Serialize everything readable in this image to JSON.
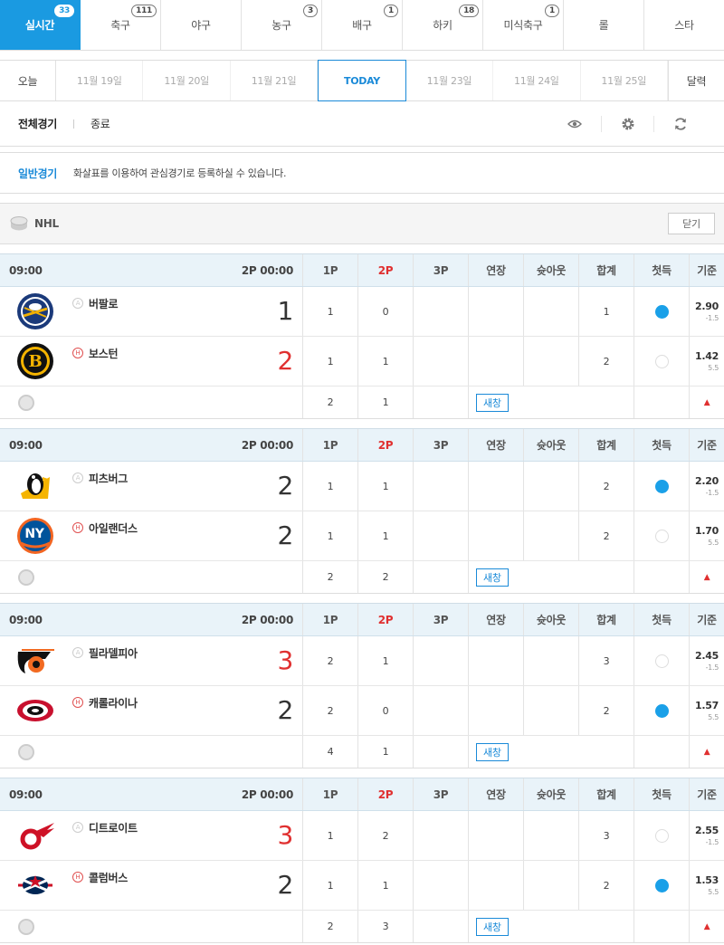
{
  "sports_tabs": [
    {
      "label": "실시간",
      "badge": "33",
      "active": true
    },
    {
      "label": "축구",
      "badge": "111"
    },
    {
      "label": "야구",
      "badge": ""
    },
    {
      "label": "농구",
      "badge": "3"
    },
    {
      "label": "배구",
      "badge": "1"
    },
    {
      "label": "하키",
      "badge": "18"
    },
    {
      "label": "미식축구",
      "badge": "1"
    },
    {
      "label": "롤",
      "badge": ""
    },
    {
      "label": "스타",
      "badge": ""
    }
  ],
  "dates": {
    "today_btn": "오늘",
    "items": [
      "11월 19일",
      "11월 20일",
      "11월 21일",
      "TODAY",
      "11월 23일",
      "11월 24일",
      "11월 25일"
    ],
    "calendar_btn": "달력"
  },
  "filter": {
    "all": "전체경기",
    "finished": "종료"
  },
  "notice": {
    "title": "일반경기",
    "text": "화살표를 이용하여 관심경기로 등록하실 수 있습니다."
  },
  "league": {
    "name": "NHL",
    "close_label": "닫기"
  },
  "columns": [
    "1P",
    "2P",
    "3P",
    "연장",
    "슛아웃",
    "합계",
    "첫득",
    "기준"
  ],
  "new_window_label": "새창",
  "games": [
    {
      "time": "09:00",
      "status": "2P 00:00",
      "away": {
        "mark": "A",
        "name": "버팔로",
        "score": "1",
        "lead": false,
        "p1": "1",
        "p2": "0",
        "total": "1",
        "first": true,
        "odds": "2.90",
        "handicap": "-1.5",
        "logo": "sabres"
      },
      "home": {
        "mark": "H",
        "name": "보스턴",
        "score": "2",
        "lead": true,
        "p1": "1",
        "p2": "1",
        "total": "2",
        "first": false,
        "odds": "1.42",
        "handicap": "5.5",
        "logo": "bruins"
      },
      "sum": {
        "p1": "2",
        "p2": "1"
      }
    },
    {
      "time": "09:00",
      "status": "2P 00:00",
      "away": {
        "mark": "A",
        "name": "피츠버그",
        "score": "2",
        "lead": false,
        "p1": "1",
        "p2": "1",
        "total": "2",
        "first": true,
        "odds": "2.20",
        "handicap": "-1.5",
        "logo": "penguins"
      },
      "home": {
        "mark": "H",
        "name": "아일랜더스",
        "score": "2",
        "lead": false,
        "p1": "1",
        "p2": "1",
        "total": "2",
        "first": false,
        "odds": "1.70",
        "handicap": "5.5",
        "logo": "islanders"
      },
      "sum": {
        "p1": "2",
        "p2": "2"
      }
    },
    {
      "time": "09:00",
      "status": "2P 00:00",
      "away": {
        "mark": "A",
        "name": "필라델피아",
        "score": "3",
        "lead": true,
        "p1": "2",
        "p2": "1",
        "total": "3",
        "first": false,
        "odds": "2.45",
        "handicap": "-1.5",
        "logo": "flyers"
      },
      "home": {
        "mark": "H",
        "name": "캐롤라이나",
        "score": "2",
        "lead": false,
        "p1": "2",
        "p2": "0",
        "total": "2",
        "first": true,
        "odds": "1.57",
        "handicap": "5.5",
        "logo": "hurricanes"
      },
      "sum": {
        "p1": "4",
        "p2": "1"
      }
    },
    {
      "time": "09:00",
      "status": "2P 00:00",
      "away": {
        "mark": "A",
        "name": "디트로이트",
        "score": "3",
        "lead": true,
        "p1": "1",
        "p2": "2",
        "total": "3",
        "first": false,
        "odds": "2.55",
        "handicap": "-1.5",
        "logo": "redwings"
      },
      "home": {
        "mark": "H",
        "name": "콜럼버스",
        "score": "2",
        "lead": false,
        "p1": "1",
        "p2": "1",
        "total": "2",
        "first": true,
        "odds": "1.53",
        "handicap": "5.5",
        "logo": "bluejackets"
      },
      "sum": {
        "p1": "2",
        "p2": "3"
      }
    }
  ]
}
